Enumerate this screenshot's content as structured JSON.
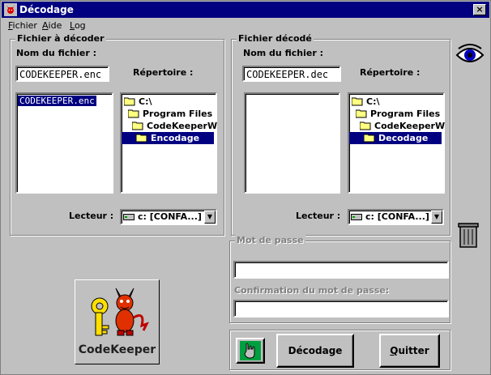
{
  "window": {
    "title": "Décodage",
    "close_label": "×"
  },
  "menu": [
    {
      "label": "Fichier",
      "accel": "F"
    },
    {
      "label": "Aide",
      "accel": "A"
    },
    {
      "label": "Log",
      "accel": "L"
    }
  ],
  "left_panel": {
    "group_title": "Fichier à décoder",
    "filename_label": "Nom du fichier :",
    "filename_value": "CODEKEEPER.enc",
    "files": [
      "CODEKEEPER.enc"
    ],
    "directory_label": "Répertoire :",
    "tree": [
      "C:\\",
      "Program Files",
      "CodeKeeperW",
      "Encodage"
    ],
    "drive_label": "Lecteur :",
    "drive_value": "c: [CONFA...]"
  },
  "right_panel": {
    "group_title": "Fichier décodé",
    "filename_label": "Nom du fichier :",
    "filename_value": "CODEKEEPER.dec",
    "files": [],
    "directory_label": "Répertoire :",
    "tree": [
      "C:\\",
      "Program Files",
      "CodeKeeperW",
      "Decodage"
    ],
    "drive_label": "Lecteur :",
    "drive_value": "c: [CONFA...]"
  },
  "password": {
    "group_title": "Mot de passe",
    "password_value": "",
    "confirm_label": "Confirmation du mot de passe:",
    "confirm_value": ""
  },
  "logo": {
    "text": "CodeKeeper"
  },
  "buttons": {
    "decode_label": "Décodage",
    "quit_label": "Quitter"
  },
  "icons": [
    "eye-icon",
    "trash-icon",
    "hand-pointer-icon",
    "app-devil-icon",
    "folder-icon",
    "drive-icon"
  ]
}
